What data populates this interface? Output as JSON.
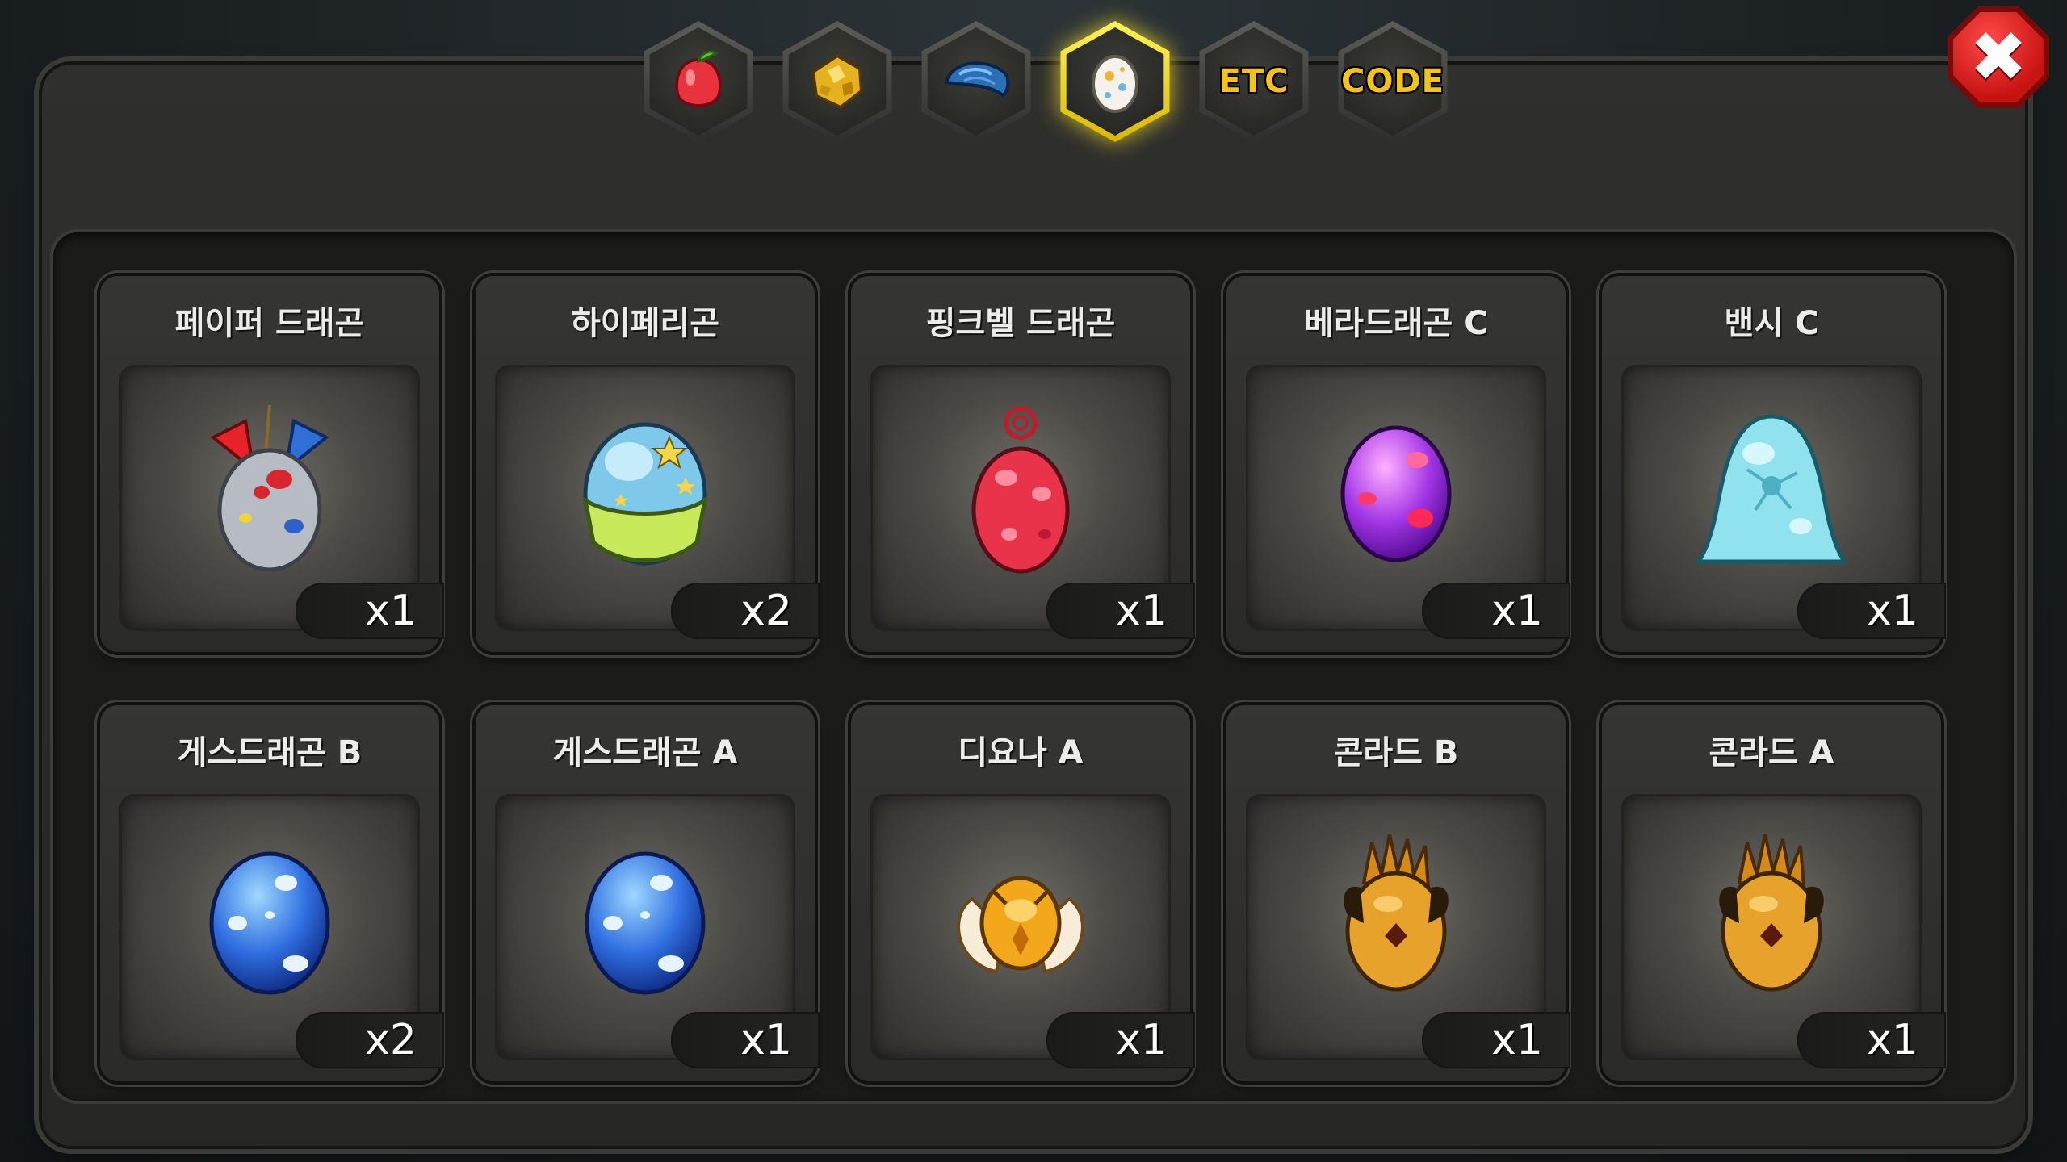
{
  "tabs": [
    {
      "name": "fruit",
      "icon": "fruit-icon",
      "label": ""
    },
    {
      "name": "ore",
      "icon": "ore-icon",
      "label": ""
    },
    {
      "name": "scale",
      "icon": "scale-icon",
      "label": ""
    },
    {
      "name": "egg",
      "icon": "egg-icon",
      "label": "",
      "active": true
    },
    {
      "name": "etc",
      "icon": "",
      "label": "ETC"
    },
    {
      "name": "code",
      "icon": "",
      "label": "CODE"
    }
  ],
  "close_label": "✖",
  "items": [
    {
      "name": "페이퍼 드래곤",
      "count": "x1",
      "icon": "paper-dragon-egg-icon"
    },
    {
      "name": "하이페리곤",
      "count": "x2",
      "icon": "hyperigon-egg-icon"
    },
    {
      "name": "핑크벨 드래곤",
      "count": "x1",
      "icon": "pinkbell-dragon-egg-icon"
    },
    {
      "name": "베라드래곤 C",
      "count": "x1",
      "icon": "vera-dragon-egg-icon"
    },
    {
      "name": "밴시 C",
      "count": "x1",
      "icon": "banshee-egg-icon"
    },
    {
      "name": "게스드래곤 B",
      "count": "x2",
      "icon": "guess-dragon-egg-icon"
    },
    {
      "name": "게스드래곤 A",
      "count": "x1",
      "icon": "guess-dragon-egg-icon"
    },
    {
      "name": "디요나 A",
      "count": "x1",
      "icon": "diyona-egg-icon"
    },
    {
      "name": "콘라드 B",
      "count": "x1",
      "icon": "conrad-egg-icon"
    },
    {
      "name": "콘라드 A",
      "count": "x1",
      "icon": "conrad-egg-icon"
    }
  ]
}
